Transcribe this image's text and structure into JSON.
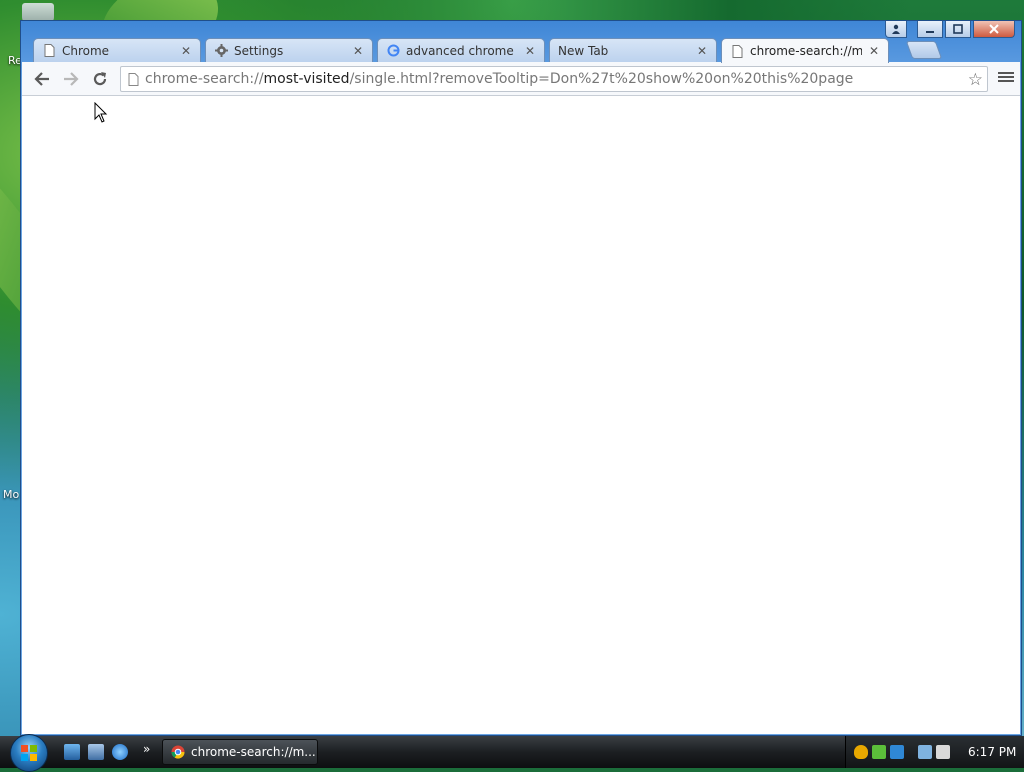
{
  "desktop": {
    "labels": [
      "Re",
      "Mo"
    ]
  },
  "window": {
    "controls": {
      "profile_icon": "profile-icon",
      "minimize_icon": "minimize-icon",
      "maximize_icon": "maximize-icon",
      "close_icon": "close-icon"
    }
  },
  "tabs": [
    {
      "title": "Chrome",
      "icon": "page-icon",
      "active": false
    },
    {
      "title": "Settings",
      "icon": "gear-icon",
      "active": false
    },
    {
      "title": "advanced chrome - G",
      "icon": "google-icon",
      "active": false
    },
    {
      "title": "New Tab",
      "icon": "",
      "active": false
    },
    {
      "title": "chrome-search://mos",
      "icon": "page-icon",
      "active": true
    }
  ],
  "toolbar": {
    "back_icon": "back-arrow-icon",
    "forward_icon": "forward-arrow-icon",
    "reload_icon": "reload-icon",
    "url_scheme": "chrome-search://",
    "url_host": "most-visited",
    "url_path": "/single.html?removeTooltip=Don%27t%20show%20on%20this%20page",
    "bookmark_icon": "star-icon",
    "menu_icon": "menu-icon"
  },
  "taskbar": {
    "task_button_label": "chrome-search://m...",
    "clock": "6:17 PM",
    "chevrons": "»"
  },
  "colors": {
    "window_frame": "#6ba5e3",
    "toolbar": "#f6f8fb",
    "content": "#ffffff",
    "taskbar": "#1c1f22"
  }
}
